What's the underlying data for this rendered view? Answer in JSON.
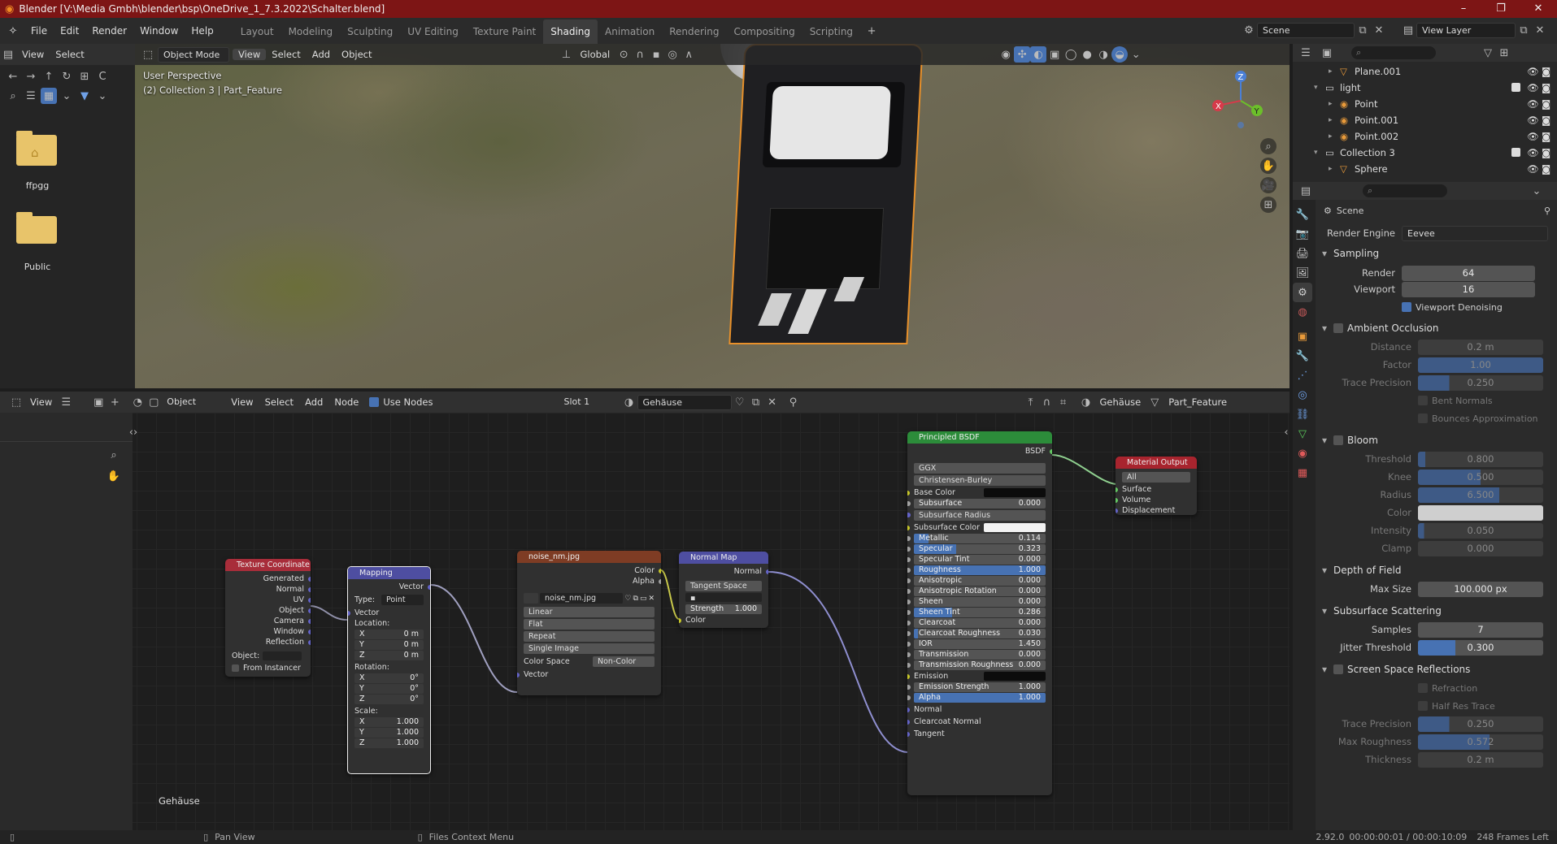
{
  "window": {
    "title": "Blender [V:\\Media Gmbh\\blender\\bsp\\OneDrive_1_7.3.2022\\Schalter.blend]",
    "minimize": "–",
    "maximize": "❐",
    "close": "✕"
  },
  "menu": [
    "File",
    "Edit",
    "Render",
    "Window",
    "Help"
  ],
  "workspaces": [
    "Layout",
    "Modeling",
    "Sculpting",
    "UV Editing",
    "Texture Paint",
    "Shading",
    "Animation",
    "Rendering",
    "Compositing",
    "Scripting"
  ],
  "active_workspace": "Shading",
  "scene_name": "Scene",
  "view_layer": "View Layer",
  "filebrowser": {
    "menu": [
      "View",
      "Select"
    ],
    "folders": [
      "ffpgg",
      "Public"
    ]
  },
  "viewport": {
    "mode": "Object Mode",
    "menu": [
      "View",
      "Select",
      "Add",
      "Object"
    ],
    "transform": "Global",
    "overlay_line1": "User Perspective",
    "overlay_line2": "(2) Collection 3 | Part_Feature"
  },
  "node_editor": {
    "view_label": "View",
    "object_label": "Object",
    "menu": [
      "View",
      "Select",
      "Add",
      "Node"
    ],
    "use_nodes": "Use Nodes",
    "slot": "Slot 1",
    "material": "Gehäuse",
    "material_right": "Gehäuse",
    "object_right": "Part_Feature",
    "footer_label": "Gehäuse"
  },
  "nodes": {
    "texcoord": {
      "title": "Texture Coordinate",
      "outputs": [
        "Generated",
        "Normal",
        "UV",
        "Object",
        "Camera",
        "Window",
        "Reflection"
      ],
      "object_label": "Object:",
      "from_instancer": "From Instancer"
    },
    "mapping": {
      "title": "Mapping",
      "out": "Vector",
      "type_label": "Type:",
      "type_value": "Point",
      "vector": "Vector",
      "location": "Location:",
      "loc": [
        [
          "X",
          "0 m"
        ],
        [
          "Y",
          "0 m"
        ],
        [
          "Z",
          "0 m"
        ]
      ],
      "rotation": "Rotation:",
      "rot": [
        [
          "X",
          "0°"
        ],
        [
          "Y",
          "0°"
        ],
        [
          "Z",
          "0°"
        ]
      ],
      "scale": "Scale:",
      "scl": [
        [
          "X",
          "1.000"
        ],
        [
          "Y",
          "1.000"
        ],
        [
          "Z",
          "1.000"
        ]
      ]
    },
    "image": {
      "title": "noise_nm.jpg",
      "out_color": "Color",
      "out_alpha": "Alpha",
      "image_name": "noise_nm.jpg",
      "interpolation": "Linear",
      "projection": "Flat",
      "extension": "Repeat",
      "source": "Single Image",
      "colorspace_label": "Color Space",
      "colorspace": "Non-Color",
      "vector": "Vector"
    },
    "normalmap": {
      "title": "Normal Map",
      "out": "Normal",
      "space": "Tangent Space",
      "strength_label": "Strength",
      "strength": "1.000",
      "color": "Color"
    },
    "bsdf": {
      "title": "Principled BSDF",
      "out": "BSDF",
      "distribution": "GGX",
      "sss_method": "Christensen-Burley",
      "base_color": "Base Color",
      "subsurface": [
        "Subsurface",
        "0.000"
      ],
      "subsurface_radius": "Subsurface Radius",
      "subsurface_color": "Subsurface Color",
      "fields": [
        [
          "Metallic",
          "0.114",
          "p11"
        ],
        [
          "Specular",
          "0.323",
          "p32"
        ],
        [
          "Specular Tint",
          "0.000",
          "p0"
        ],
        [
          "Roughness",
          "1.000",
          "p100"
        ],
        [
          "Anisotropic",
          "0.000",
          "p0"
        ],
        [
          "Anisotropic Rotation",
          "0.000",
          "p0"
        ],
        [
          "Sheen",
          "0.000",
          "p0"
        ],
        [
          "Sheen Tint",
          "0.286",
          "p29"
        ],
        [
          "Clearcoat",
          "0.000",
          "p0"
        ],
        [
          "Clearcoat Roughness",
          "0.030",
          "p3"
        ],
        [
          "IOR",
          "1.450",
          "p0"
        ],
        [
          "Transmission",
          "0.000",
          "p0"
        ],
        [
          "Transmission Roughness",
          "0.000",
          "p0"
        ]
      ],
      "emission": "Emission",
      "emission_strength": [
        "Emission Strength",
        "1.000"
      ],
      "alpha": [
        "Alpha",
        "1.000"
      ],
      "normal": "Normal",
      "clearcoat_normal": "Clearcoat Normal",
      "tangent": "Tangent"
    },
    "output": {
      "title": "Material Output",
      "target": "All",
      "inputs": [
        "Surface",
        "Volume",
        "Displacement"
      ]
    }
  },
  "outliner": {
    "rows": [
      {
        "name": "Plane.001",
        "indent": 2,
        "icon": "mesh"
      },
      {
        "name": "light",
        "indent": 1,
        "icon": "collection"
      },
      {
        "name": "Point",
        "indent": 2,
        "icon": "light"
      },
      {
        "name": "Point.001",
        "indent": 2,
        "icon": "light"
      },
      {
        "name": "Point.002",
        "indent": 2,
        "icon": "light"
      },
      {
        "name": "Collection 3",
        "indent": 1,
        "icon": "collection"
      },
      {
        "name": "Sphere",
        "indent": 2,
        "icon": "mesh"
      }
    ]
  },
  "properties": {
    "context": "Scene",
    "render_engine_label": "Render Engine",
    "render_engine": "Eevee",
    "sampling": {
      "title": "Sampling",
      "render_label": "Render",
      "render": "64",
      "viewport_label": "Viewport",
      "viewport": "16",
      "denoise": "Viewport Denoising"
    },
    "ao": {
      "title": "Ambient Occlusion",
      "distance": [
        "Distance",
        "0.2 m"
      ],
      "factor": [
        "Factor",
        "1.00"
      ],
      "trace": [
        "Trace Precision",
        "0.250"
      ],
      "bent": "Bent Normals",
      "bounces": "Bounces Approximation"
    },
    "bloom": {
      "title": "Bloom",
      "threshold": [
        "Threshold",
        "0.800"
      ],
      "knee": [
        "Knee",
        "0.500"
      ],
      "radius": [
        "Radius",
        "6.500"
      ],
      "color": "Color",
      "intensity": [
        "Intensity",
        "0.050"
      ],
      "clamp": [
        "Clamp",
        "0.000"
      ]
    },
    "dof": {
      "title": "Depth of Field",
      "max_size": [
        "Max Size",
        "100.000 px"
      ]
    },
    "sss": {
      "title": "Subsurface Scattering",
      "samples": [
        "Samples",
        "7"
      ],
      "jitter": [
        "Jitter Threshold",
        "0.300"
      ]
    },
    "ssr": {
      "title": "Screen Space Reflections",
      "refraction": "Refraction",
      "half_res": "Half Res Trace",
      "trace": [
        "Trace Precision",
        "0.250"
      ],
      "max_rough": [
        "Max Roughness",
        "0.572"
      ],
      "thickness": [
        "Thickness",
        "0.2 m"
      ]
    }
  },
  "statusbar": {
    "pan": "Pan View",
    "context": "Files Context Menu",
    "version": "2.92.0",
    "time": "00:00:00:01 / 00:00:10:09",
    "frames": "248 Frames Left"
  },
  "colors": {
    "accent": "#4772b3",
    "titlebar": "#7d1515",
    "node_texture": "#7e3c24",
    "node_input": "#a82d3a",
    "node_vector": "#4e4ea1",
    "node_shader": "#2c8c3a",
    "node_output": "#a8242e"
  }
}
